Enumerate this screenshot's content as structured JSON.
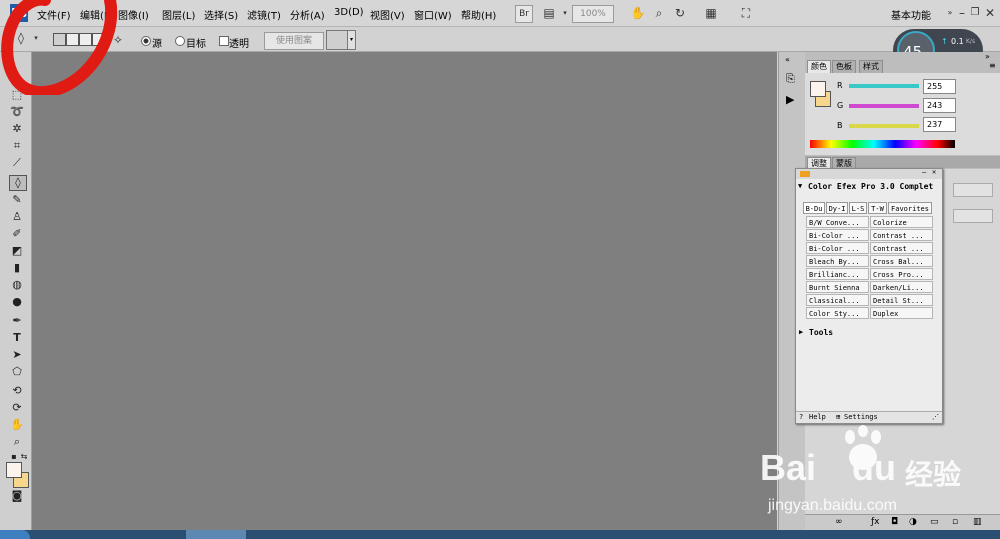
{
  "menubar": {
    "logo": "Ps",
    "items": [
      "文件(F)",
      "编辑(E)",
      "图像(I)",
      "图层(L)",
      "选择(S)",
      "滤镜(T)",
      "分析(A)",
      "3D(D)",
      "视图(V)",
      "窗口(W)",
      "帮助(H)"
    ],
    "bridge_label": "Br",
    "zoom": "100%",
    "workspace": "基本功能"
  },
  "options": {
    "radio_source": "源",
    "radio_target": "目标",
    "transparent": "透明",
    "use_pattern": "使用图案"
  },
  "perf": {
    "cpu": "45",
    "unit": "%",
    "up": "0.1",
    "down": "0",
    "rate_unit": "K/s"
  },
  "panels": {
    "color_tabs": [
      "颜色",
      "色板",
      "样式"
    ],
    "adjust_tabs": [
      "调整",
      "蒙版"
    ],
    "rgb": [
      {
        "channel": "R",
        "value": "255",
        "color": "#38c8c8"
      },
      {
        "channel": "G",
        "value": "243",
        "color": "#d04ad0"
      },
      {
        "channel": "B",
        "value": "237",
        "color": "#d8d84a"
      }
    ]
  },
  "efex": {
    "title": "Color Efex Pro 3.0 Complet",
    "tabs": [
      "B-Du",
      "Dy-I",
      "L-S",
      "T-W",
      "Favorites"
    ],
    "filters_left": [
      "B/W Conve...",
      "Bi-Color ...",
      "Bi-Color ...",
      "Bleach By...",
      "Brillianc...",
      "Burnt Sienna",
      "Classical...",
      "Color Sty..."
    ],
    "filters_right": [
      "Colorize",
      "Contrast ...",
      "Contrast ...",
      "Cross Bal...",
      "Cross Pro...",
      "Darken/Li...",
      "Detail St...",
      "Duplex"
    ],
    "tools": "Tools",
    "help": "Help",
    "settings": "Settings"
  },
  "watermark": {
    "brand": "Bai",
    "brand2": "du",
    "cn": "经验",
    "url": "jingyan.baidu.com"
  },
  "colors": {
    "canvas": "#7f7f7f",
    "fg": "#fdf3ed",
    "bg": "#f6d68a",
    "marker": "#e01b14"
  }
}
